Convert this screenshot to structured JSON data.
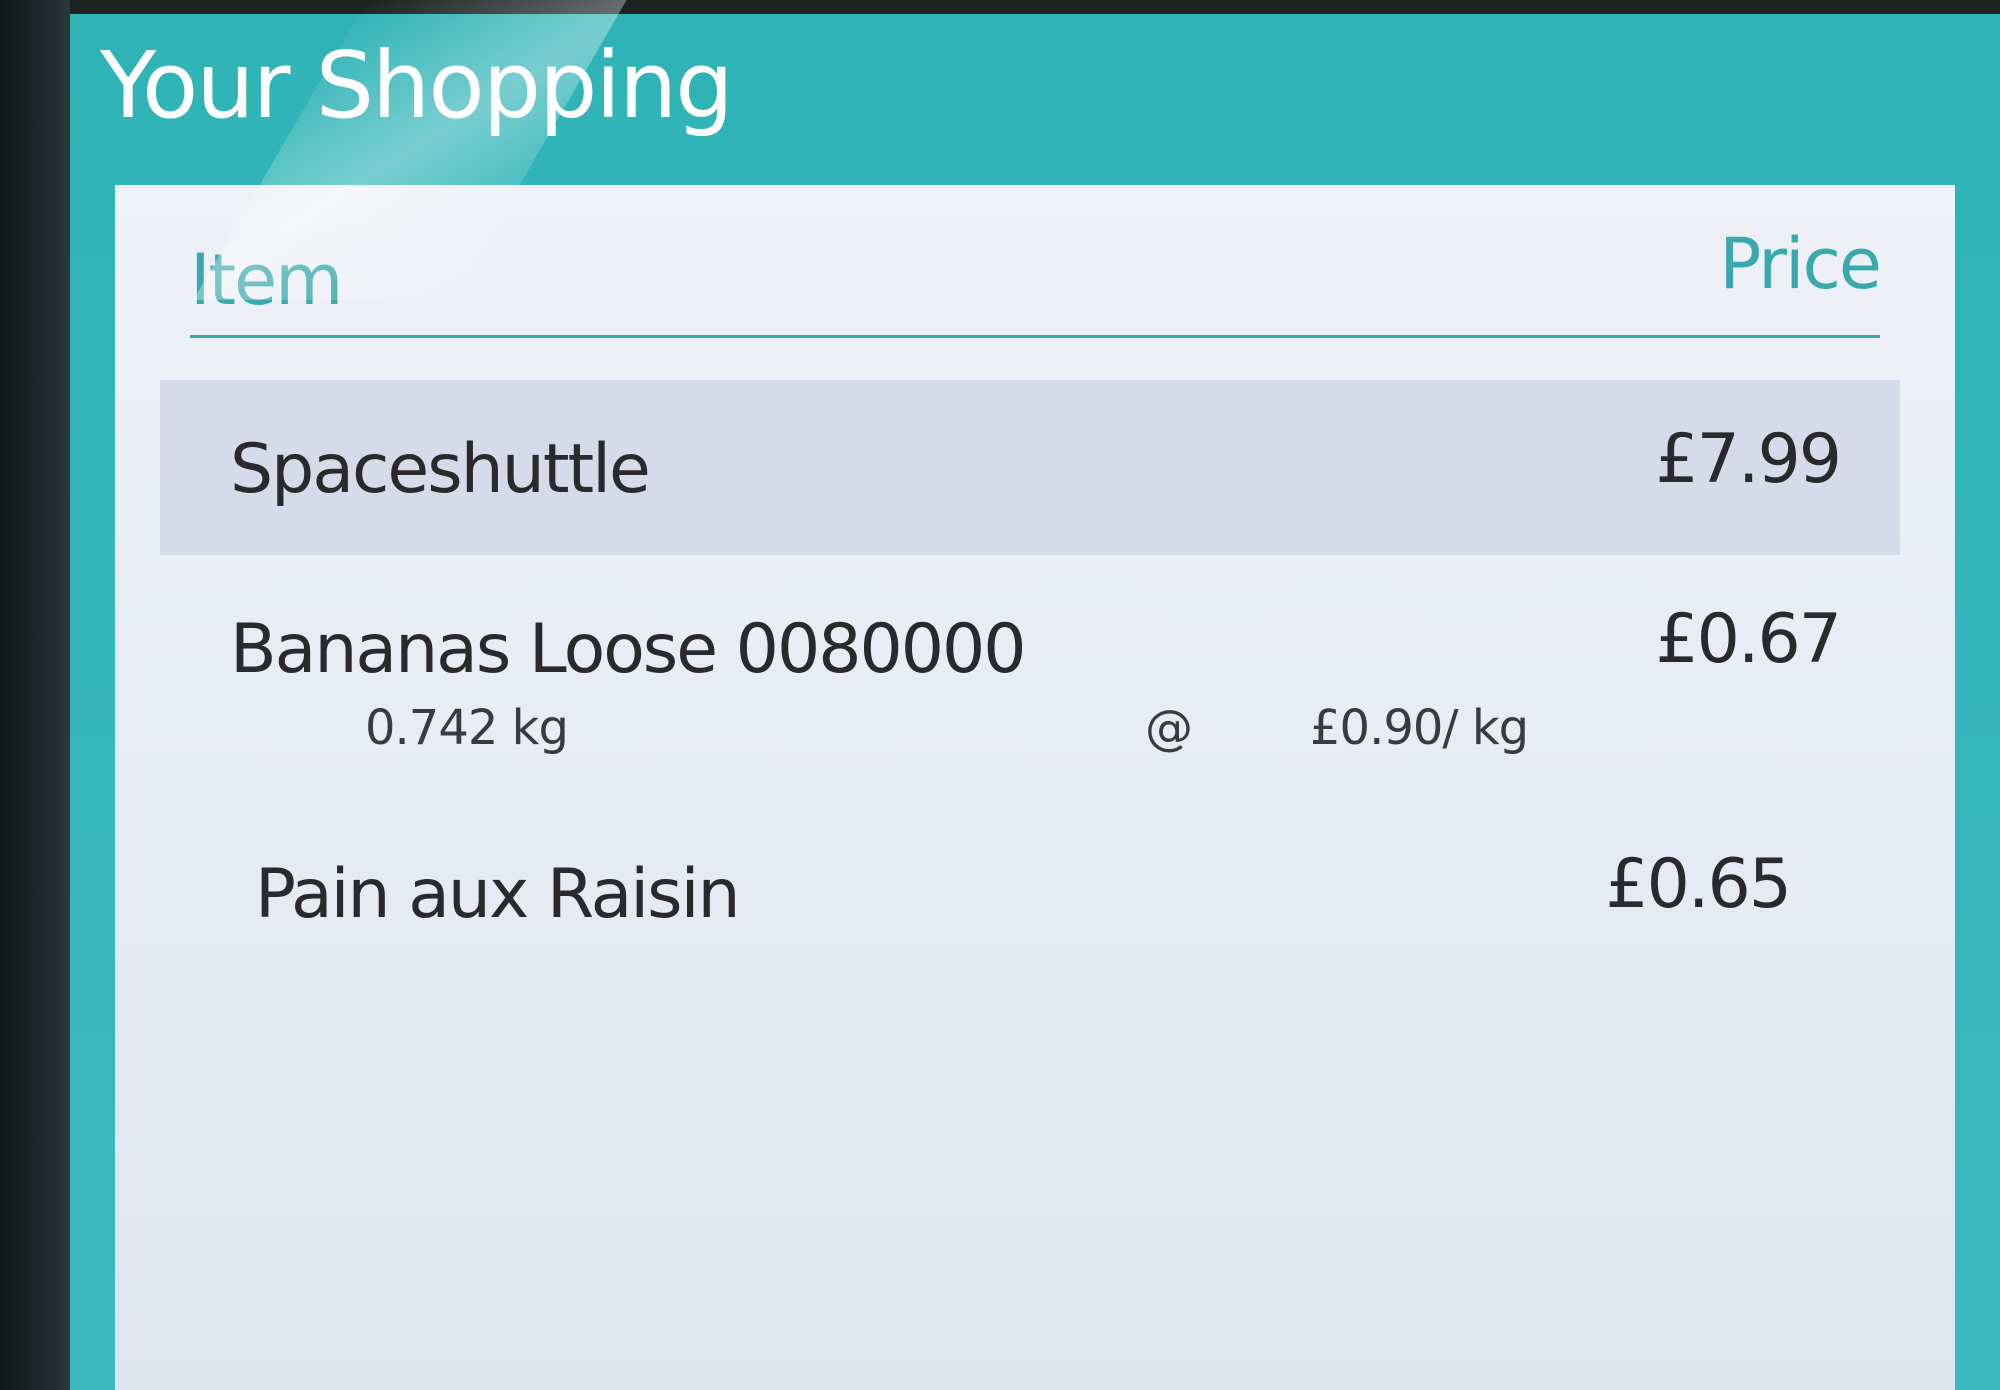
{
  "window": {
    "title": "Your Shopping"
  },
  "table": {
    "headers": {
      "item": "Item",
      "price": "Price"
    },
    "rows": [
      {
        "name": "Spaceshuttle",
        "price": "£7.99"
      },
      {
        "name": "Bananas Loose 0080000",
        "price": "£0.67",
        "weight": "0.742 kg",
        "at": "@",
        "unit_price": "£0.90/ kg"
      },
      {
        "name": "Pain aux Raisin",
        "price": "£0.65"
      }
    ]
  },
  "colors": {
    "accent": "#3aa9ad",
    "header_bg": "#34b6bb",
    "selected_row": "#d5dbea"
  }
}
